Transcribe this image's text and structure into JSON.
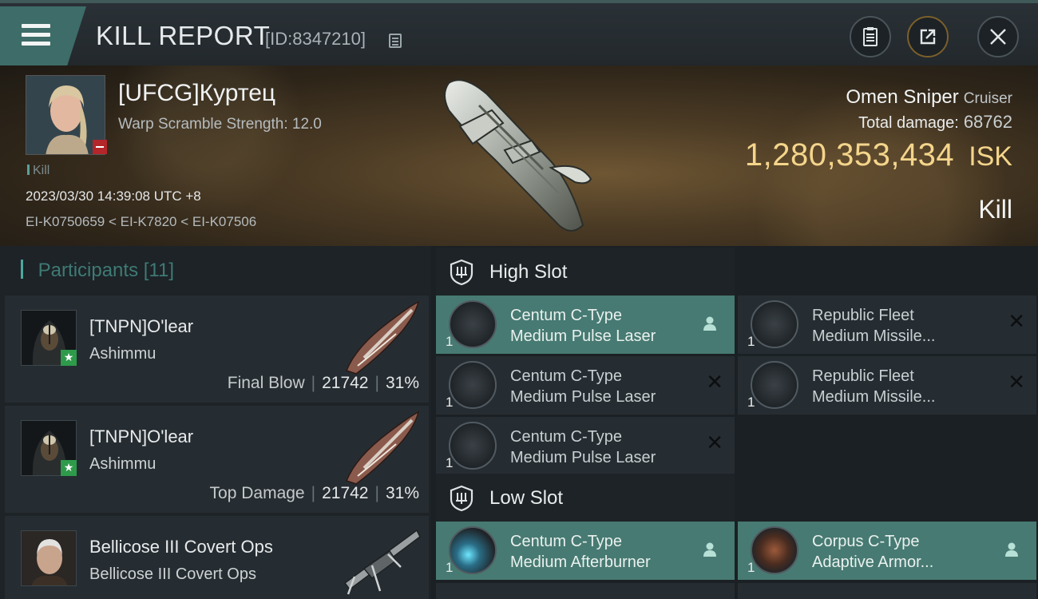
{
  "header": {
    "title": "KILL REPORT",
    "report_id": "[ID:8347210]"
  },
  "victim": {
    "name": "[UFCG]Куртец",
    "stat": "Warp Scramble Strength: 12.0",
    "tag": "Kill",
    "time": "2023/03/30 14:39:08 UTC +8",
    "location": "EI-K0750659 < EI-K7820 < EI-K07506"
  },
  "ship": {
    "name": "Omen Sniper",
    "class": "Cruiser",
    "total_damage_label": "Total damage:",
    "total_damage": "68762",
    "isk_value": "1,280,353,434",
    "isk_unit": "ISK",
    "result": "Kill"
  },
  "participants": {
    "label": "Participants",
    "count": "[11]",
    "items": [
      {
        "name": "[TNPN]O'lear",
        "ship": "Ashimmu",
        "tag": "Final Blow",
        "damage": "21742",
        "percent": "31%"
      },
      {
        "name": "[TNPN]O'lear",
        "ship": "Ashimmu",
        "tag": "Top Damage",
        "damage": "21742",
        "percent": "31%"
      },
      {
        "name": "Bellicose III Covert Ops",
        "ship": "Bellicose III Covert Ops"
      }
    ]
  },
  "fittings": {
    "high_slot_label": "High Slot",
    "low_slot_label": "Low Slot",
    "high": [
      {
        "qty": "1",
        "line1": "Centum C-Type",
        "line2": "Medium Pulse Laser",
        "status": "pilot-icon"
      },
      {
        "qty": "1",
        "line1": "Republic Fleet",
        "line2": "Medium Missile...",
        "status": "destroyed-icon"
      },
      {
        "qty": "1",
        "line1": "Centum C-Type",
        "line2": "Medium Pulse Laser",
        "status": "destroyed-icon"
      },
      {
        "qty": "1",
        "line1": "Republic Fleet",
        "line2": "Medium Missile...",
        "status": "destroyed-icon"
      },
      {
        "qty": "1",
        "line1": "Centum C-Type",
        "line2": "Medium Pulse Laser",
        "status": "destroyed-icon"
      }
    ],
    "low": [
      {
        "qty": "1",
        "line1": "Centum C-Type",
        "line2": "Medium Afterburner",
        "status": "pilot-icon"
      },
      {
        "qty": "1",
        "line1": "Corpus C-Type",
        "line2": "Adaptive Armor...",
        "status": "pilot-icon"
      }
    ]
  },
  "colors": {
    "accent": "#477a72",
    "isk_gold": "#f4d58b",
    "final_blow_star": "#2e9b4b",
    "minus_badge": "#b3262a"
  }
}
